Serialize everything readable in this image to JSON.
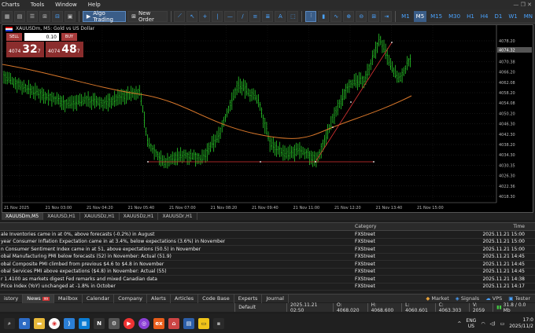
{
  "menu": [
    "Charts",
    "Tools",
    "Window",
    "Help"
  ],
  "toolbar": {
    "algo_label": "Algo Trading",
    "new_order_label": "New Order",
    "timeframes": [
      "M1",
      "M5",
      "M15",
      "M30",
      "H1",
      "H4",
      "D1",
      "W1",
      "MN"
    ],
    "active_tf": "M5"
  },
  "chart": {
    "title": "XAUUSDm, M5:  Gold vs US Dollar",
    "sell_label": "SELL",
    "buy_label": "BUY",
    "lot": "0.10",
    "bid_small": "4074",
    "bid_big": "32",
    "bid_sup": "7",
    "ask_small": "4074",
    "ask_big": "48",
    "ask_sup": "7"
  },
  "chart_data": {
    "type": "candlestick",
    "price_labels": [
      "4078.20",
      "4074.32",
      "4070.38",
      "4066.20",
      "4062.08",
      "4058.20",
      "4054.08",
      "4050.20",
      "4046.30",
      "4042.30",
      "4038.20",
      "4034.30",
      "4030.35",
      "4026.30",
      "4022.36",
      "4018.30"
    ],
    "time_labels": [
      "21 Nov 2025",
      "21 Nov 03:00",
      "21 Nov 04:20",
      "21 Nov 05:40",
      "21 Nov 07:00",
      "21 Nov 08:20",
      "21 Nov 09:40",
      "21 Nov 11:00",
      "21 Nov 12:20",
      "21 Nov 13:40",
      "21 Nov 15:00"
    ],
    "current_price": "4074.32",
    "indicators": [
      "moving-average-orange",
      "trendline-red"
    ]
  },
  "symbol_tabs": [
    "XAUUSDm,M5",
    "XAUUSD,H1",
    "XAUUSDz,H1",
    "XAUUSDz,H1",
    "XAUUSDr,H1"
  ],
  "news": {
    "headers": {
      "category": "Category",
      "time": "Time"
    },
    "rows": [
      {
        "subject": "ale Inventories came in at 0%, above forecasts (-0.2%) in August",
        "category": "FXStreet",
        "time": "2025.11.21 15:00"
      },
      {
        "subject": "year Consumer Inflation Expectation came in at 3.4%, below expectations (3.6%) in November",
        "category": "FXStreet",
        "time": "2025.11.21 15:00"
      },
      {
        "subject": "n Consumer Sentiment Index came in at 51, above expectations (50.5) in November",
        "category": "FXStreet",
        "time": "2025.11.21 15:00"
      },
      {
        "subject": "obal Manufacturing PMI below forecasts (52) in November: Actual (51.9)",
        "category": "FXStreet",
        "time": "2025.11.21 14:45"
      },
      {
        "subject": "obal Composite PMI climbed from previous $4.6 to $4.8 in November",
        "category": "FXStreet",
        "time": "2025.11.21 14:45"
      },
      {
        "subject": "obal Services PMI above expectations ($4.8) in November: Actual (55)",
        "category": "FXStreet",
        "time": "2025.11.21 14:45"
      },
      {
        "subject": "r 1.4100 as markets digest Fed remarks and mixed Canadian data",
        "category": "FXStreet",
        "time": "2025.11.21 14:38"
      },
      {
        "subject": "Price Index (YoY) unchanged at -1.8% in October",
        "category": "FXStreet",
        "time": "2025.11.21 14:17"
      }
    ]
  },
  "bottom_tabs": [
    "istory",
    "News",
    "Mailbox",
    "Calendar",
    "Company",
    "Alerts",
    "Articles",
    "Code Base",
    "Experts",
    "Journal"
  ],
  "news_badge": "99",
  "bottom_right": [
    "Market",
    "Signals",
    "VPS",
    "Tester"
  ],
  "status": {
    "profile": "Default",
    "datetime": "2025.11.21 02:50",
    "open": "O: 4068.020",
    "high": "H: 4068.600",
    "low": "L: 4060.601",
    "close": "C: 4063.303",
    "volume": "V: 2059",
    "conn": "31.8 / 0.0 Mb"
  },
  "taskbar": {
    "lang1": "ENG",
    "lang2": "US",
    "time": "17:0",
    "date": "2025/11/2"
  }
}
